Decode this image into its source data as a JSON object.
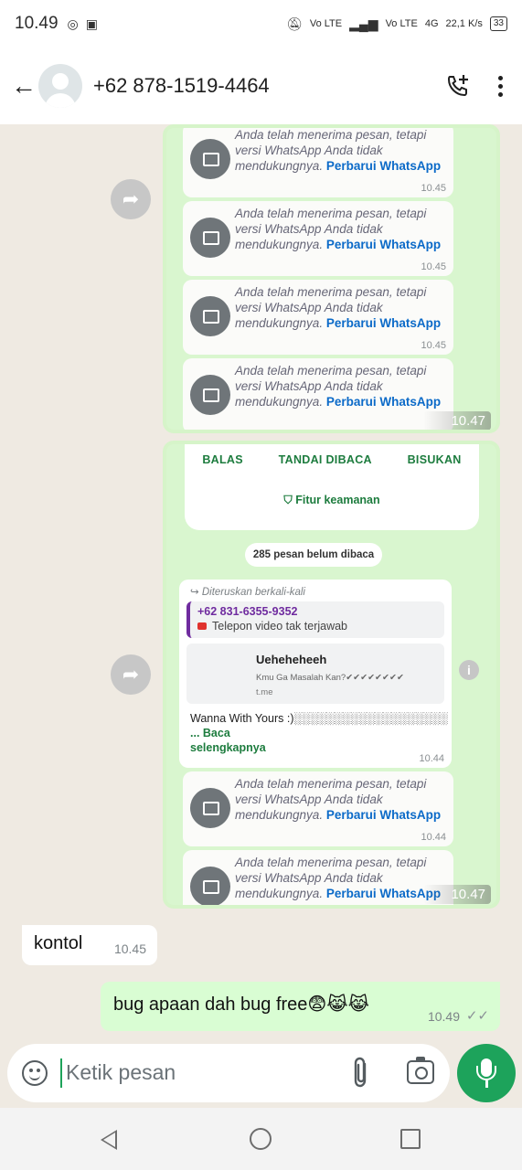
{
  "status_bar": {
    "time": "10.49",
    "network_left": "Vo LTE",
    "network_right": "Vo LTE",
    "network_type": "4G",
    "speed": "22,1 K/s",
    "battery": "33",
    "icons": [
      "whatsapp-icon",
      "game-icon",
      "mute-icon",
      "signal-icon"
    ]
  },
  "header": {
    "back_icon": "arrow-left-icon",
    "contact": "+62 878-1519-4464",
    "call_icon": "add-call-icon",
    "more_icon": "more-vertical-icon"
  },
  "screenshot_top": {
    "unsupported_messages": [
      {
        "text": "Anda telah menerima pesan, tetapi versi WhatsApp Anda tidak mendukungnya.",
        "link": "Perbarui WhatsApp",
        "time": "10.45"
      },
      {
        "text": "Anda telah menerima pesan, tetapi versi WhatsApp Anda tidak mendukungnya.",
        "link": "Perbarui WhatsApp",
        "time": "10.45"
      },
      {
        "text": "Anda telah menerima pesan, tetapi versi WhatsApp Anda tidak mendukungnya.",
        "link": "Perbarui WhatsApp",
        "time": "10.45"
      },
      {
        "text": "Anda telah menerima pesan, tetapi versi WhatsApp Anda tidak mendukungnya.",
        "link": "Perbarui WhatsApp",
        "time": ""
      }
    ],
    "time": "10.47"
  },
  "screenshot_bottom": {
    "actions": [
      "BALAS",
      "TANDAI DIBACA",
      "BISUKAN"
    ],
    "security": "Fitur keamanan",
    "unread": "285 pesan belum dibaca",
    "forwarded_label": "Diteruskan berkali-kali",
    "quoted_name": "+62 831-6355-9352",
    "quoted_text": "Telepon video tak terjawab",
    "link_title": "Ueheheheeh",
    "link_desc": "Kmu Ga Masalah Kan?✔✔✔✔✔✔✔✔",
    "link_domain": "t.me",
    "body_text": "Wanna With Yours :)░░░░░░░░░░░░░░░░░░░░░░░░",
    "body_more": "... Baca selengkapnya",
    "body_time": "10.44",
    "unsupported_messages": [
      {
        "text": "Anda telah menerima pesan, tetapi versi WhatsApp Anda tidak mendukungnya.",
        "link": "Perbarui WhatsApp",
        "time": "10.44"
      },
      {
        "text": "Anda telah menerima pesan, tetapi versi WhatsApp Anda tidak mendukungnya.",
        "link": "Perbarui WhatsApp",
        "time": ""
      }
    ],
    "time": "10.47"
  },
  "messages": {
    "received": {
      "text": "kontol",
      "time": "10.45"
    },
    "sent": {
      "text": "bug apaan dah bug free😨😹😹",
      "time": "10.49"
    }
  },
  "input": {
    "placeholder": "Ketik pesan",
    "emoji_icon": "sticker-icon",
    "attach_icon": "paperclip-icon",
    "camera_icon": "camera-icon",
    "mic_icon": "mic-icon"
  },
  "colors": {
    "brand_green": "#1da35b",
    "link_blue": "#0b6ac8",
    "sent_bubble": "#d9fdd3"
  }
}
